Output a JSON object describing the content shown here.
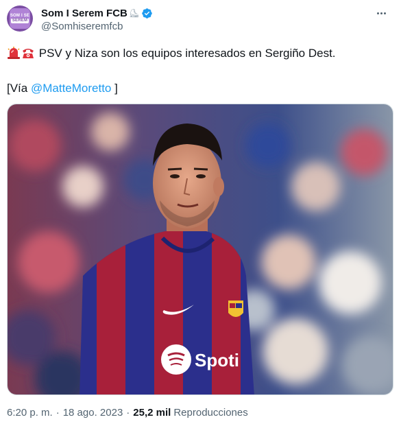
{
  "author": {
    "display_name": "Som I Serem FCB",
    "name_emoji": "⛸",
    "handle": "@Somhiseremfcb",
    "avatar_top_text": "SOM I SE",
    "avatar_bottom_text": "SEREM"
  },
  "tweet": {
    "text": "PSV y Niza son los equipos interesados en Sergiño Dest.",
    "via_prefix": "[Vía ",
    "via_mention": "@MatteMoretto",
    "via_suffix": " ]",
    "emojis": [
      "rotating-light-emoji",
      "telephone-emoji"
    ]
  },
  "media": {
    "jersey_sponsor": "Spoti"
  },
  "footer": {
    "time": "6:20 p. m.",
    "date": "18 ago. 2023",
    "separator": "·",
    "views_count": "25,2 mil",
    "views_label": "Reproducciones"
  },
  "colors": {
    "accent": "#1d9bf0",
    "text_primary": "#0f1419",
    "text_secondary": "#536471",
    "border": "#cfd9de"
  },
  "icons": {
    "verified": "verified-badge-icon",
    "more": "more-options-icon"
  }
}
